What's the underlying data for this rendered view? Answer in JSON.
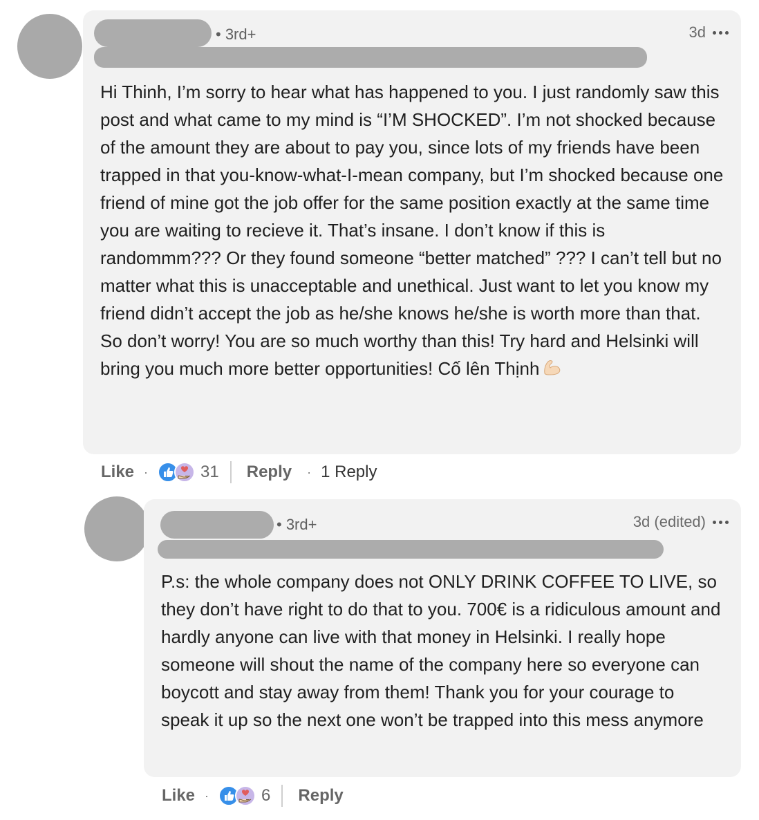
{
  "comment": {
    "degree": "• 3rd+",
    "time": "3d",
    "text": "Hi Thinh, I’m sorry to hear what has happened to you. I just randomly saw this post and what came to my mind is “I’M SHOCKED”. I’m not shocked because of the amount they are about to pay you, since lots of my friends have been trapped in that you-know-what-I-mean company, but I’m shocked because one friend of mine got the job offer for the same position  exactly at the same time you are waiting to recieve it. That’s insane. I don’t know if this is randommm??? Or they found someone “better matched” ??? I can’t tell but no matter what this is unacceptable and unethical. Just want to let you know my friend didn’t accept the job as he/she knows he/she is worth more than that. So don’t worry! You are so much worthy than this! Try hard and Helsinki will bring you much more better opportunities! Cố lên Thịnh",
    "emoji_icon": "flexed-biceps-icon",
    "like_label": "Like",
    "reaction_count": "31",
    "reply_label": "Reply",
    "replies_label": "1 Reply"
  },
  "reply": {
    "degree": "• 3rd+",
    "time": "3d (edited)",
    "text": "P.s: the whole company does not ONLY DRINK COFFEE TO LIVE, so they don’t have right to do that to you. 700€ is a ridiculous amount and hardly anyone can live with that money in Helsinki. I really hope someone will shout the name of the company here so everyone can boycott and stay away from them! Thank you for your courage to speak it up so the next one won’t be trapped into this mess anymore",
    "like_label": "Like",
    "reaction_count": "6",
    "reply_label": "Reply"
  },
  "colors": {
    "bubble": "#f2f2f2",
    "redacted": "#acacac",
    "like_blue": "#378fe9",
    "support_purple": "#c7b6e8"
  }
}
